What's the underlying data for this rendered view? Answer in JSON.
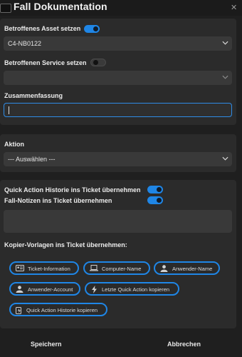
{
  "window": {
    "title": "Fall Dokumentation",
    "close_icon": "close-icon"
  },
  "asset": {
    "label": "Betroffenes Asset setzen",
    "toggle_on": true,
    "value": "C4-NB0122"
  },
  "service": {
    "label": "Betroffenen Service setzen",
    "toggle_on": false,
    "value": ""
  },
  "summary": {
    "label": "Zusammenfassung",
    "value": ""
  },
  "action": {
    "label": "Aktion",
    "value": "--- Auswählen ---"
  },
  "options": {
    "quick_action_label": "Quick Action Historie ins Ticket übernehmen",
    "quick_action_on": true,
    "notes_label": "Fall-Notizen ins Ticket übernehmen",
    "notes_on": true
  },
  "templates": {
    "label": "Kopier-Vorlagen ins Ticket übernehmen:",
    "chips": [
      {
        "label": "Ticket-Information",
        "icon": "id-card-icon"
      },
      {
        "label": "Computer-Name",
        "icon": "laptop-icon"
      },
      {
        "label": "Anwender-Name",
        "icon": "user-icon"
      },
      {
        "label": "Anwender-Account",
        "icon": "user-icon"
      },
      {
        "label": "Letzte Quick Action kopieren",
        "icon": "lightning-icon"
      },
      {
        "label": "Quick Action Historie kopieren",
        "icon": "history-icon"
      }
    ]
  },
  "footer": {
    "save_label": "Speichern",
    "cancel_label": "Abbrechen"
  },
  "colors": {
    "accent": "#1f86e6",
    "background": "#1f1f1f",
    "panel": "#2b2b2b",
    "field": "#393939"
  }
}
